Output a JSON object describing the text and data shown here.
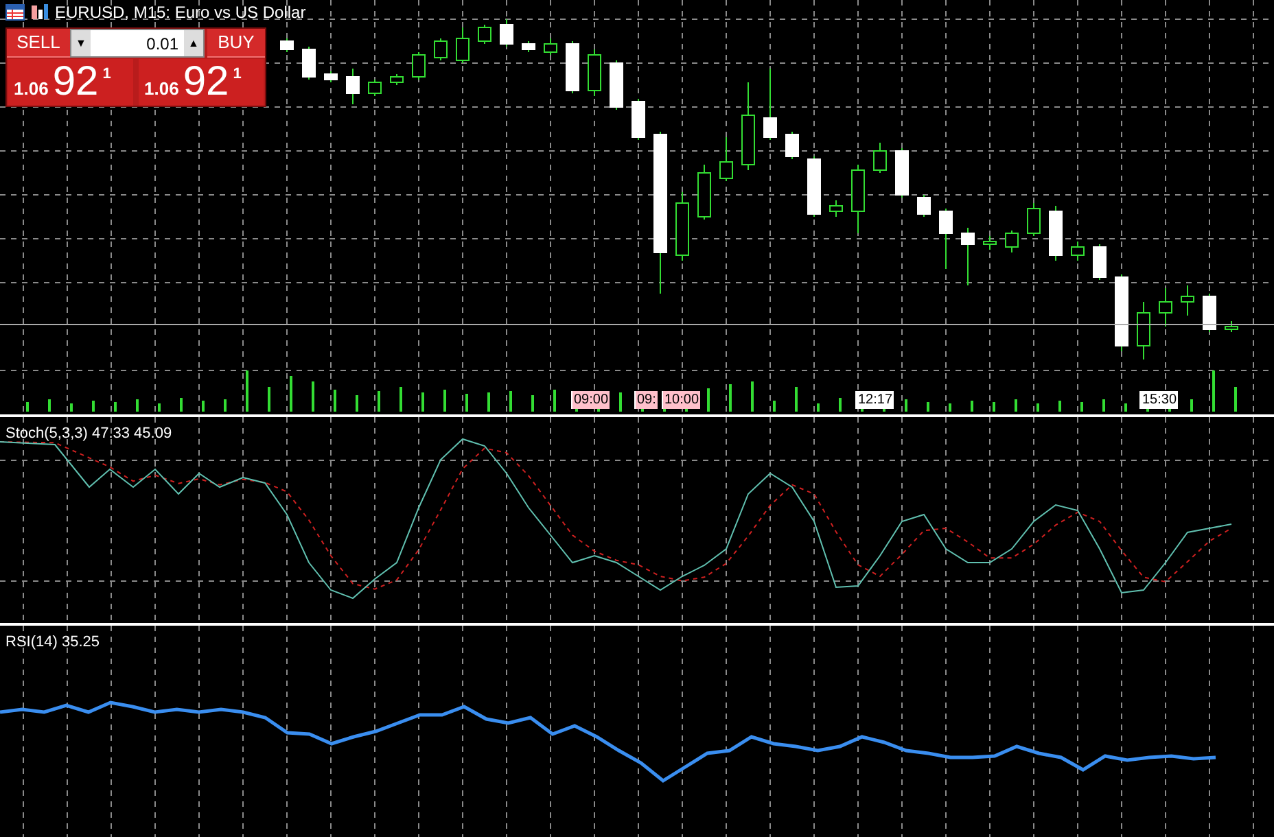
{
  "chart_title": "EURUSD, M15: Euro vs US Dollar",
  "trade_panel": {
    "sell_label": "SELL",
    "buy_label": "BUY",
    "lot": "0.01",
    "down_arrow": "▼",
    "up_arrow": "▲",
    "sell_price": {
      "prefix": "1.06",
      "big": "92",
      "small": "1"
    },
    "buy_price": {
      "prefix": "1.06",
      "big": "92",
      "small": "1"
    }
  },
  "time_markers": [
    {
      "label": "09:00",
      "color": "#ffc0cb"
    },
    {
      "label": "09:",
      "color": "#ffc0cb"
    },
    {
      "label": "10:00",
      "color": "#ffc0cb"
    },
    {
      "label": "12:17",
      "color": "#ffffff"
    },
    {
      "label": "15:30",
      "color": "#ffffff"
    }
  ],
  "stochastic": {
    "label": "Stoch(5,3,3) 47.33 45.09"
  },
  "rsi": {
    "label": "RSI(14) 35.25"
  }
}
